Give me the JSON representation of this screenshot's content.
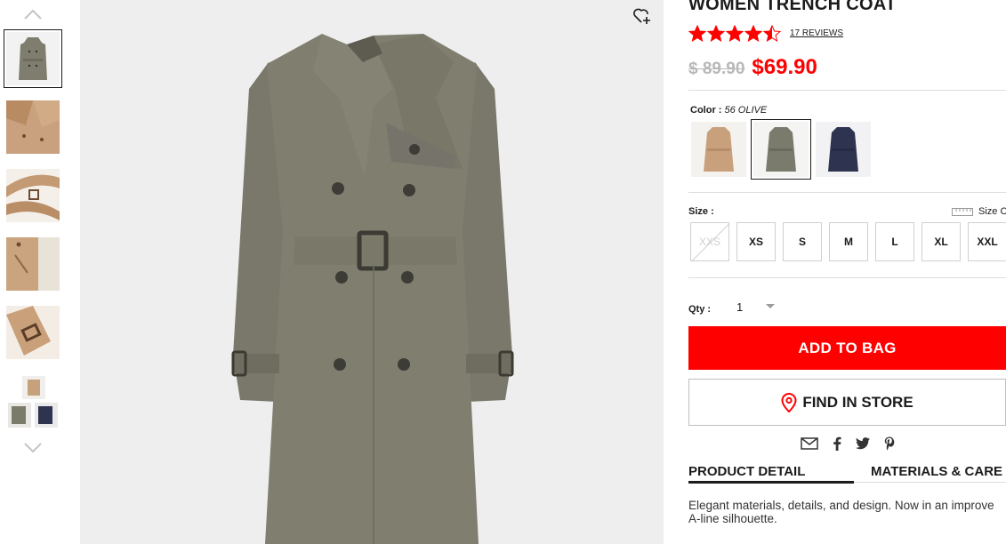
{
  "product": {
    "title": "WOMEN TRENCH COAT",
    "rating": 4.5,
    "reviews_label": "17 REVIEWS",
    "price_old": "$ 89.90",
    "price_new": "$69.90"
  },
  "gallery": {
    "thumbnails": [
      {
        "name": "olive-coat-front",
        "selected": true
      },
      {
        "name": "beige-collar-detail",
        "selected": false
      },
      {
        "name": "belt-detail",
        "selected": false
      },
      {
        "name": "pocket-detail",
        "selected": false
      },
      {
        "name": "cuff-detail",
        "selected": false
      },
      {
        "name": "color-variants",
        "selected": false
      }
    ]
  },
  "color": {
    "label": "Color :",
    "value": "56 OLIVE",
    "swatches": [
      {
        "name": "beige",
        "hex": "#c8a07c",
        "selected": false
      },
      {
        "name": "olive",
        "hex": "#7a7b6c",
        "selected": true
      },
      {
        "name": "navy",
        "hex": "#2e3350",
        "selected": false
      }
    ]
  },
  "size": {
    "label": "Size :",
    "chart_label": "Size C",
    "options": [
      {
        "label": "XXS",
        "available": false
      },
      {
        "label": "XS",
        "available": true
      },
      {
        "label": "S",
        "available": true
      },
      {
        "label": "M",
        "available": true
      },
      {
        "label": "L",
        "available": true
      },
      {
        "label": "XL",
        "available": true
      },
      {
        "label": "XXL",
        "available": true
      }
    ]
  },
  "qty": {
    "label": "Qty :",
    "value": "1"
  },
  "actions": {
    "add_to_bag": "ADD TO BAG",
    "find_in_store": "FIND IN STORE"
  },
  "share_icons": [
    "email-icon",
    "facebook-icon",
    "twitter-icon",
    "pinterest-icon"
  ],
  "tabs": [
    {
      "label": "PRODUCT DETAIL",
      "active": true
    },
    {
      "label": "MATERIALS & CARE",
      "active": false
    }
  ],
  "description_line1": "Elegant materials, details, and design. Now in an improve",
  "description_line2": "A-line silhouette.",
  "colors": {
    "accent_red": "#ff0000",
    "text": "#1b1b1b",
    "image_bg": "#eeeeee",
    "coat_olive": "#7f7d6d"
  }
}
